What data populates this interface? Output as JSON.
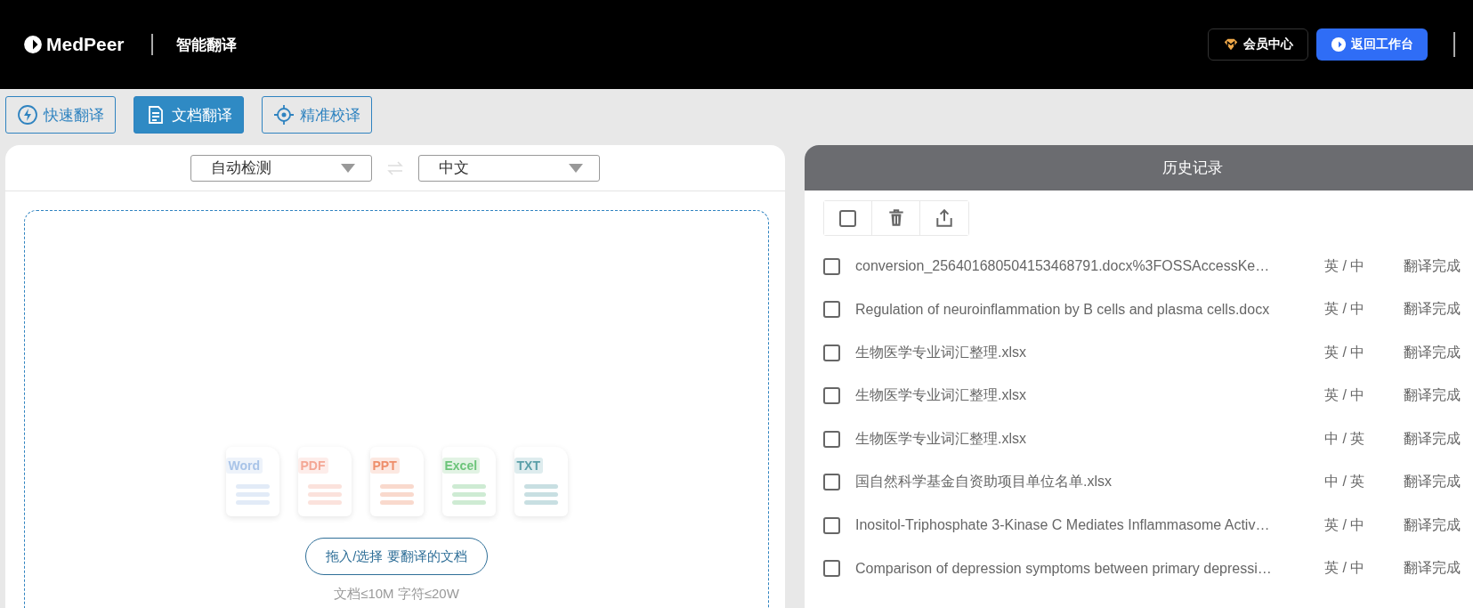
{
  "header": {
    "logo": "MedPeer",
    "product": "智能翻译",
    "member_button": "会员中心",
    "workspace_button": "返回工作台"
  },
  "modes": [
    {
      "label": "快速翻译",
      "selected": false
    },
    {
      "label": "文档翻译",
      "selected": true
    },
    {
      "label": "精准校译",
      "selected": false
    }
  ],
  "languages": {
    "source": "自动检测",
    "target": "中文"
  },
  "upload": {
    "file_types": [
      {
        "label": "Word",
        "color": "#a9c4e8"
      },
      {
        "label": "PDF",
        "color": "#f4a795"
      },
      {
        "label": "PPT",
        "color": "#ee8e6a"
      },
      {
        "label": "Excel",
        "color": "#6cc47a"
      },
      {
        "label": "TXT",
        "color": "#5a9fa8"
      }
    ],
    "button": "拖入/选择 要翻译的文档",
    "hint": "文档≤10M 字符≤20W"
  },
  "history": {
    "title": "历史记录",
    "select_all_checked": false,
    "rows": [
      {
        "name": "conversion_256401680504153468791.docx%3FOSSAccessKe…",
        "langs": "英 / 中",
        "status": "翻译完成",
        "checked": false
      },
      {
        "name": "Regulation of neuroinflammation by B cells and plasma cells.docx",
        "langs": "英 / 中",
        "status": "翻译完成",
        "checked": false
      },
      {
        "name": "生物医学专业词汇整理.xlsx",
        "langs": "英 / 中",
        "status": "翻译完成",
        "checked": false
      },
      {
        "name": "生物医学专业词汇整理.xlsx",
        "langs": "英 / 中",
        "status": "翻译完成",
        "checked": false
      },
      {
        "name": "生物医学专业词汇整理.xlsx",
        "langs": "中 / 英",
        "status": "翻译完成",
        "checked": false
      },
      {
        "name": "国自然科学基金自资助项目单位名单.xlsx",
        "langs": "中 / 英",
        "status": "翻译完成",
        "checked": false
      },
      {
        "name": "Inositol-Triphosphate 3-Kinase C Mediates Inflammasome Activ…",
        "langs": "英 / 中",
        "status": "翻译完成",
        "checked": false
      },
      {
        "name": "Comparison of depression symptoms between primary depressi…",
        "langs": "英 / 中",
        "status": "翻译完成",
        "checked": false
      }
    ]
  }
}
